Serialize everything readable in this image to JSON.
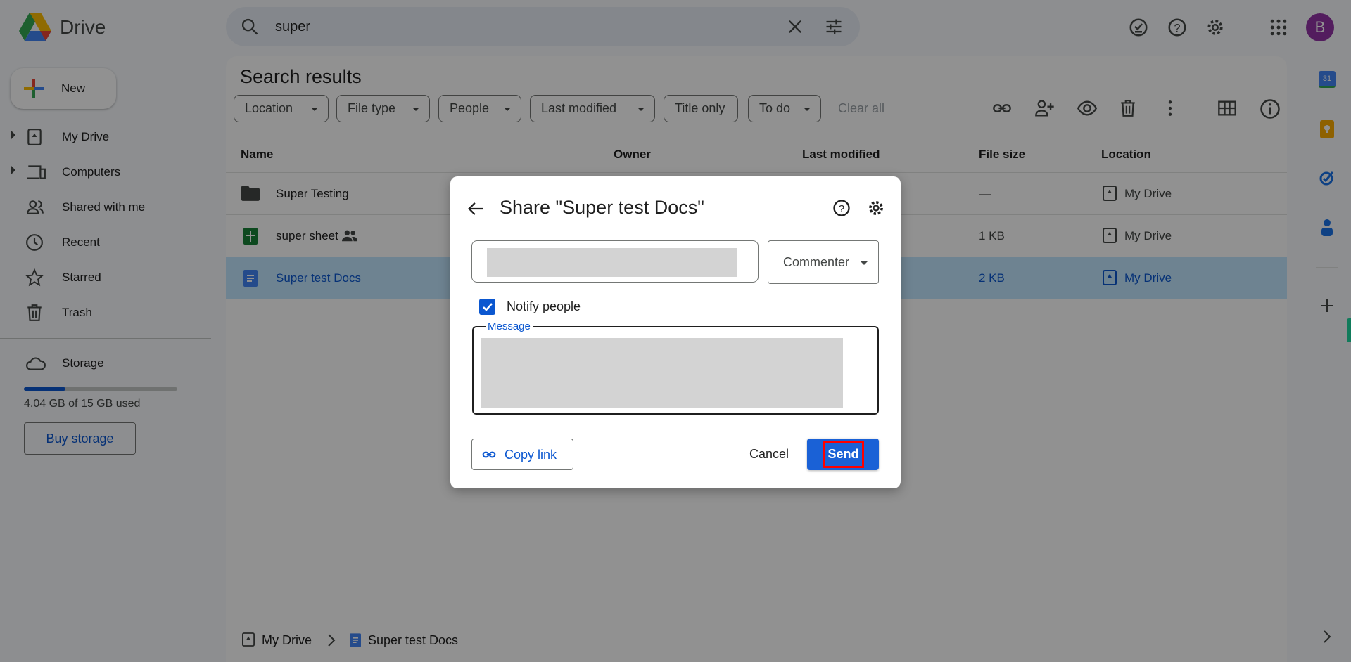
{
  "app": {
    "name": "Drive",
    "avatar_letter": "B",
    "avatar_color": "#9334a6"
  },
  "search": {
    "value": "super"
  },
  "sidebar": {
    "new_label": "New",
    "items": [
      {
        "label": "My Drive"
      },
      {
        "label": "Computers"
      },
      {
        "label": "Shared with me"
      },
      {
        "label": "Recent"
      },
      {
        "label": "Starred"
      },
      {
        "label": "Trash"
      }
    ],
    "storage": {
      "label": "Storage",
      "used_text": "4.04 GB of 15 GB used",
      "used_fraction": 0.27,
      "buy_label": "Buy storage"
    }
  },
  "main": {
    "title": "Search results",
    "filters": [
      "Location",
      "File type",
      "People",
      "Last modified",
      "Title only",
      "To do"
    ],
    "clear_all": "Clear all",
    "columns": [
      "Name",
      "Owner",
      "Last modified",
      "File size",
      "Location"
    ],
    "rows": [
      {
        "name": "Super Testing",
        "type": "folder",
        "size": "—",
        "location": "My Drive",
        "shared": false,
        "selected": false
      },
      {
        "name": "super sheet",
        "type": "sheet",
        "size": "1 KB",
        "location": "My Drive",
        "shared": true,
        "selected": false
      },
      {
        "name": "Super test Docs",
        "type": "doc",
        "size": "2 KB",
        "location": "My Drive",
        "shared": false,
        "selected": true
      }
    ],
    "breadcrumb": [
      "My Drive",
      "Super test Docs"
    ]
  },
  "dialog": {
    "title": "Share \"Super test Docs\"",
    "role": "Commenter",
    "notify_label": "Notify people",
    "notify_checked": true,
    "message_label": "Message",
    "copy_link": "Copy link",
    "cancel": "Cancel",
    "send": "Send"
  },
  "colors": {
    "accent": "#0b57d0",
    "send_bg": "#1a61d6",
    "highlight": "#ff0000",
    "selected_row": "#c2e7ff"
  }
}
